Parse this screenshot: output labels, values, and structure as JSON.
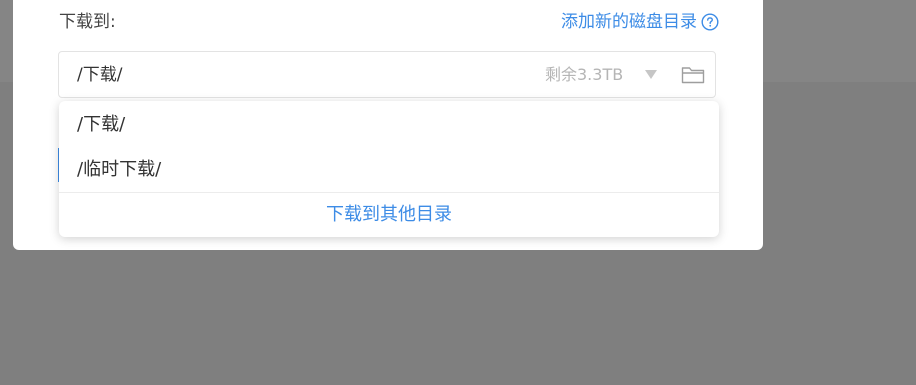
{
  "dialog": {
    "download_to_label": "下载到:",
    "add_dir_link": "添加新的磁盘目录",
    "select": {
      "value": "/下载/",
      "free_space": "剩余3.3TB"
    },
    "dropdown": {
      "items": [
        {
          "label": "/下载/"
        },
        {
          "label": "/临时下载/"
        }
      ],
      "footer_action": "下载到其他目录"
    }
  },
  "colors": {
    "accent": "#3d8ce6",
    "overlay": "#7f7f7f",
    "muted_text": "#b5b5b5"
  },
  "icons": {
    "help": "question-circle-icon",
    "caret": "caret-down-icon",
    "folder": "folder-icon"
  }
}
